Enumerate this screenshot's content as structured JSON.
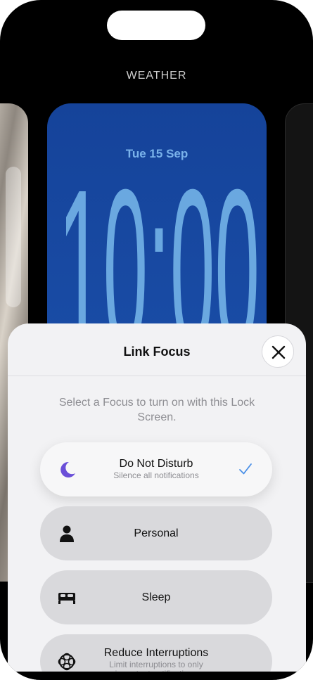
{
  "wallpaper": {
    "label": "WEATHER"
  },
  "lockscreen": {
    "date": "Tue 15 Sep",
    "time": "10:00"
  },
  "sheet": {
    "title": "Link Focus",
    "prompt": "Select a Focus to turn on with this Lock Screen.",
    "options": [
      {
        "icon": "moon-icon",
        "label": "Do Not Disturb",
        "subtitle": "Silence all notifications",
        "selected": true
      },
      {
        "icon": "person-icon",
        "label": "Personal",
        "subtitle": "",
        "selected": false
      },
      {
        "icon": "bed-icon",
        "label": "Sleep",
        "subtitle": "",
        "selected": false
      },
      {
        "icon": "reduce-interruptions-icon",
        "label": "Reduce Interruptions",
        "subtitle": "Limit interruptions to only important notifications",
        "selected": false
      }
    ]
  },
  "colors": {
    "accent": "#4a8fe7",
    "moon": "#6a4fd8",
    "wallpaper_blue": "#1a4ea8",
    "time_blue": "#6aa8e0"
  }
}
